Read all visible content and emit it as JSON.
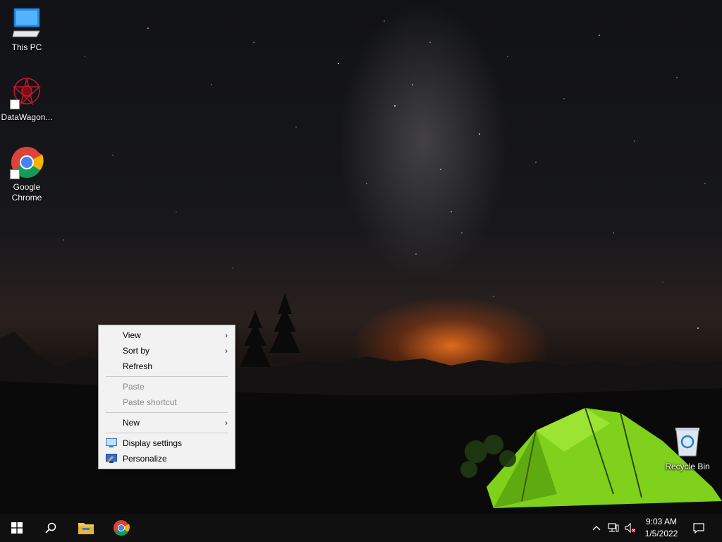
{
  "desktop": {
    "icons": [
      {
        "label": "This PC",
        "icon": "monitor-icon"
      },
      {
        "label": "DataWagon...",
        "icon": "datawagon-icon"
      },
      {
        "label": "Google Chrome",
        "icon": "chrome-icon"
      },
      {
        "label": "Recycle Bin",
        "icon": "recycle-bin-icon"
      }
    ]
  },
  "context_menu": {
    "items": [
      {
        "label": "View",
        "submenu": true,
        "enabled": true
      },
      {
        "label": "Sort by",
        "submenu": true,
        "enabled": true
      },
      {
        "label": "Refresh",
        "submenu": false,
        "enabled": true
      },
      {
        "label": "Paste",
        "submenu": false,
        "enabled": false
      },
      {
        "label": "Paste shortcut",
        "submenu": false,
        "enabled": false
      },
      {
        "label": "New",
        "submenu": true,
        "enabled": true
      },
      {
        "label": "Display settings",
        "submenu": false,
        "enabled": true,
        "icon": "display-icon"
      },
      {
        "label": "Personalize",
        "submenu": false,
        "enabled": true,
        "icon": "personalize-icon"
      }
    ],
    "submenu_arrow": "›"
  },
  "taskbar": {
    "start_icon": "windows-logo-icon",
    "search_icon": "search-icon",
    "pinned": [
      {
        "name": "File Explorer",
        "icon": "folder-icon"
      },
      {
        "name": "Google Chrome",
        "icon": "chrome-icon"
      }
    ],
    "tray": {
      "overflow_icon": "chevron-up-icon",
      "network_icon": "network-icon",
      "volume_icon": "volume-muted-icon"
    },
    "clock": {
      "time": "9:03 AM",
      "date": "1/5/2022"
    },
    "notification_icon": "notification-icon"
  },
  "colors": {
    "taskbar_bg": "#101010",
    "menu_bg": "#f2f2f2",
    "disabled_text": "#8a8a8a",
    "tent_green": "#7fd11c"
  }
}
